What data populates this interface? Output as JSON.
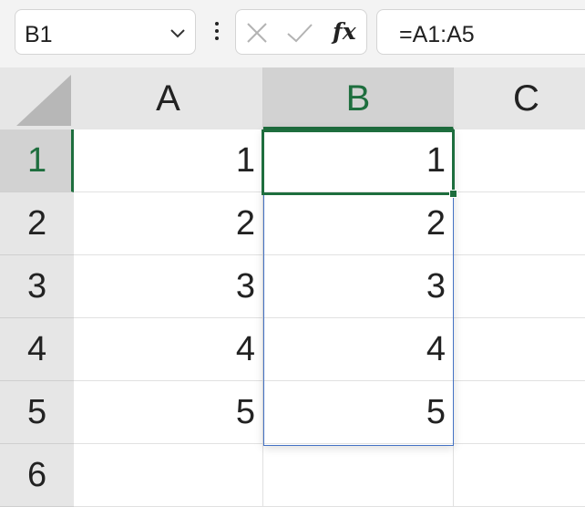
{
  "formula_bar": {
    "name_box": "B1",
    "fx_label": "fx",
    "formula": "=A1:A5"
  },
  "columns": [
    {
      "label": "A"
    },
    {
      "label": "B"
    },
    {
      "label": "C"
    }
  ],
  "rows": [
    {
      "label": "1",
      "a": "1",
      "b": "1"
    },
    {
      "label": "2",
      "a": "2",
      "b": "2"
    },
    {
      "label": "3",
      "a": "3",
      "b": "3"
    },
    {
      "label": "4",
      "a": "4",
      "b": "4"
    },
    {
      "label": "5",
      "a": "5",
      "b": "5"
    },
    {
      "label": "6",
      "a": "",
      "b": ""
    }
  ],
  "selection": {
    "active_cell": "B1",
    "spill_range": "B1:B5"
  },
  "colors": {
    "accent_green": "#1e6e3e",
    "spill_blue": "#4472c4"
  }
}
